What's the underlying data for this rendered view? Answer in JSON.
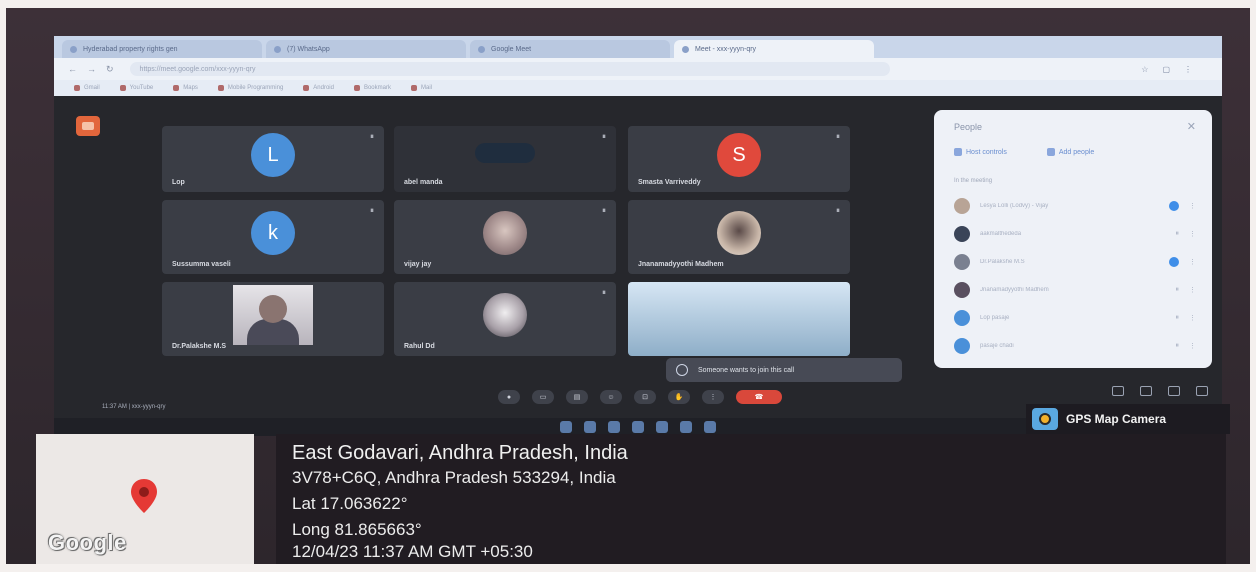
{
  "browser": {
    "tabs": [
      {
        "label": "Hyderabad property rights gen",
        "active": false
      },
      {
        "label": "(7) WhatsApp",
        "active": false
      },
      {
        "label": "Google Meet",
        "active": false
      },
      {
        "label": "Meet - xxx-yyyn-qry",
        "active": true
      }
    ],
    "url": "https://meet.google.com/xxx-yyyn-qry",
    "bookmarks": [
      "Gmail",
      "YouTube",
      "Maps",
      "Mobile Programming",
      "Android",
      "Bookmark",
      "Mail"
    ]
  },
  "meet": {
    "tiles": [
      {
        "name": "Lop",
        "initial": "L",
        "avatar_color": "#4a90d9",
        "kind": "initial"
      },
      {
        "name": "abel manda",
        "initial": "",
        "avatar_color": "",
        "kind": "dark"
      },
      {
        "name": "Smasta Varriveddy",
        "initial": "S",
        "avatar_color": "#e0493c",
        "kind": "initial"
      },
      {
        "name": "Sussumma vaseli",
        "initial": "k",
        "avatar_color": "#4a90d9",
        "kind": "initial"
      },
      {
        "name": "vijay jay",
        "initial": "",
        "avatar_color": "",
        "kind": "photo"
      },
      {
        "name": "Jnanamadyyothi Madhem",
        "initial": "",
        "avatar_color": "",
        "kind": "photo"
      },
      {
        "name": "Dr.Palakshe M.S",
        "initial": "",
        "avatar_color": "",
        "kind": "camera"
      },
      {
        "name": "Rahul Dd",
        "initial": "",
        "avatar_color": "",
        "kind": "photo"
      },
      {
        "name": "",
        "initial": "",
        "avatar_color": "",
        "kind": "bigcam"
      }
    ],
    "toast": "Someone wants to join this call",
    "meeting_code": "11:37 AM  |  xxx-yyyn-qry",
    "end_call_label": "☎"
  },
  "people_panel": {
    "title": "People",
    "close": "✕",
    "add_people": "Add people",
    "host_controls": "Host controls",
    "section": "In the meeting",
    "rows": [
      "Lesya Lolli (Lodvy) - Vijay",
      "aakmalthededa",
      "Dr.Palakshe M.S",
      "Jnanamadyyothi Madhem",
      "Lop pasaje",
      "pasaje chadi"
    ]
  },
  "gps": {
    "app_label": "GPS Map Camera",
    "map_brand": "Google",
    "location_title": "East Godavari, Andhra Pradesh, India",
    "address": "3V78+C6Q, Andhra Pradesh 533294, India",
    "lat": "Lat 17.063622°",
    "long": "Long 81.865663°",
    "datetime": "12/04/23 11:37 AM GMT +05:30",
    "pin_color": "#e53935"
  }
}
